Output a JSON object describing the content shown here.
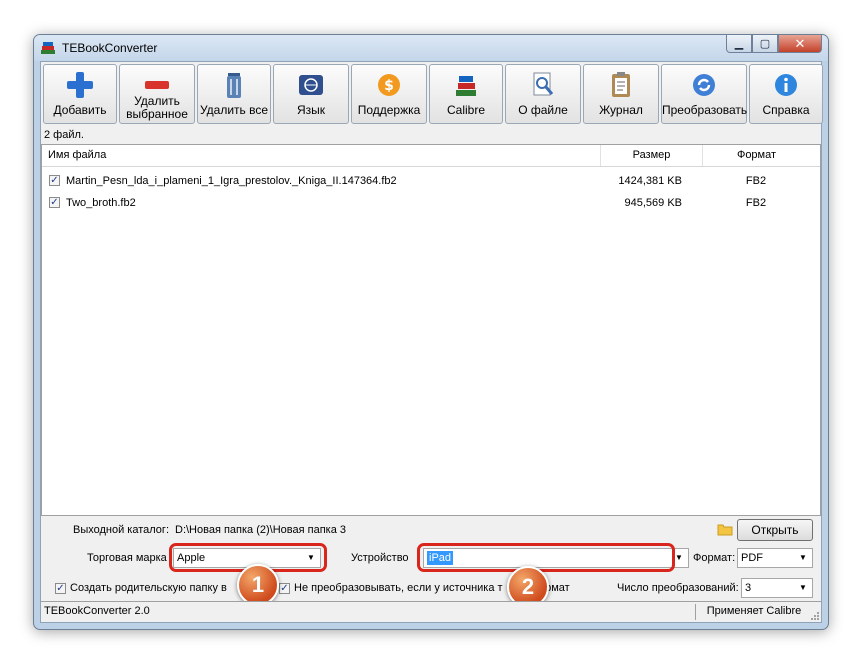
{
  "window": {
    "title": "TEBookConverter"
  },
  "toolbar": {
    "buttons": [
      {
        "label": "Добавить",
        "icon": "plus-icon"
      },
      {
        "label": "Удалить выбранное",
        "icon": "minus-icon"
      },
      {
        "label": "Удалить все",
        "icon": "trash-icon"
      },
      {
        "label": "Язык",
        "icon": "language-icon"
      },
      {
        "label": "Поддержка",
        "icon": "support-coin-icon"
      },
      {
        "label": "Calibre",
        "icon": "books-icon"
      },
      {
        "label": "О файле",
        "icon": "magnifier-icon"
      },
      {
        "label": "Журнал",
        "icon": "clipboard-icon"
      },
      {
        "label": "Преобразовать",
        "icon": "convert-icon"
      },
      {
        "label": "Справка",
        "icon": "info-icon"
      }
    ]
  },
  "file_count": "2 файл.",
  "table": {
    "headers": {
      "name": "Имя файла",
      "size": "Размер",
      "format": "Формат"
    },
    "rows": [
      {
        "checked": true,
        "name": "Martin_Pesn_lda_i_plameni_1_Igra_prestolov._Kniga_II.147364.fb2",
        "size": "1424,381 KB",
        "format": "FB2"
      },
      {
        "checked": true,
        "name": "Two_broth.fb2",
        "size": "945,569 KB",
        "format": "FB2"
      }
    ]
  },
  "output": {
    "label": "Выходной каталог:",
    "path": "D:\\Новая папка (2)\\Новая папка 3",
    "open_label": "Открыть"
  },
  "brand": {
    "label": "Торговая марка",
    "value": "Apple"
  },
  "device": {
    "label": "Устройство",
    "value": "iPad"
  },
  "format": {
    "label": "Формат:",
    "value": "PDF"
  },
  "options": {
    "create_parent_label": "Создать родительскую папку в",
    "create_parent_checked": true,
    "no_convert_label": "Не преобразовывать, если у источника т",
    "no_convert_tail": "ормат",
    "no_convert_checked": true,
    "threads_label": "Число преобразований:",
    "threads_value": "3"
  },
  "markers": {
    "one": "1",
    "two": "2"
  },
  "status": {
    "left": "TEBookConverter 2.0",
    "right": "Применяет Calibre"
  },
  "colors": {
    "highlight": "#d9261c",
    "selection": "#3399ff"
  }
}
